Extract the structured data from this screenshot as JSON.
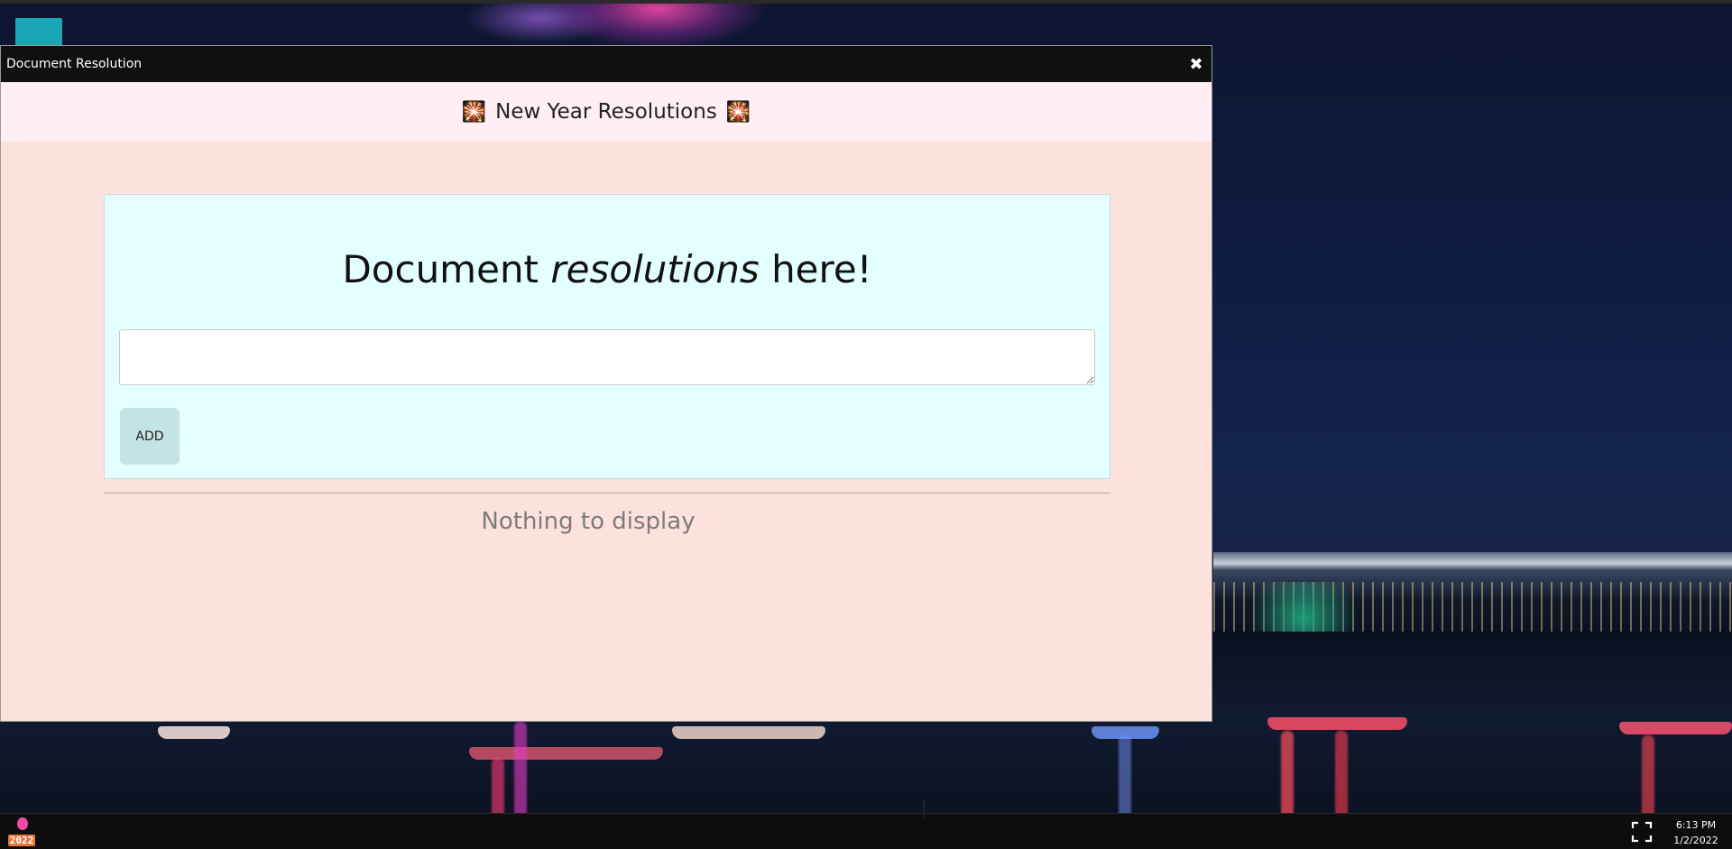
{
  "window": {
    "title": "Document Resolution",
    "close_icon": "close-icon"
  },
  "app": {
    "header_title": "New Year Resolutions",
    "header_emoji_left": "🎇",
    "header_emoji_right": "🎇",
    "heading_before": "Document",
    "heading_emphasis": "resolutions",
    "heading_after": "here!",
    "input_value": "",
    "add_label": "ADD",
    "empty_message": "Nothing to display"
  },
  "taskbar": {
    "start_badge": "2022",
    "fullscreen_icon": "fullscreen-icon",
    "time": "6:13 PM",
    "date": "1/2/2022"
  },
  "colors": {
    "window_body": "#fde1dd",
    "header_bg": "#ffeef4",
    "card_bg": "#e4ffff",
    "add_button_bg": "#c4e4e4",
    "launcher_tile": "#1aa6b4",
    "titlebar_bg": "#101010"
  }
}
